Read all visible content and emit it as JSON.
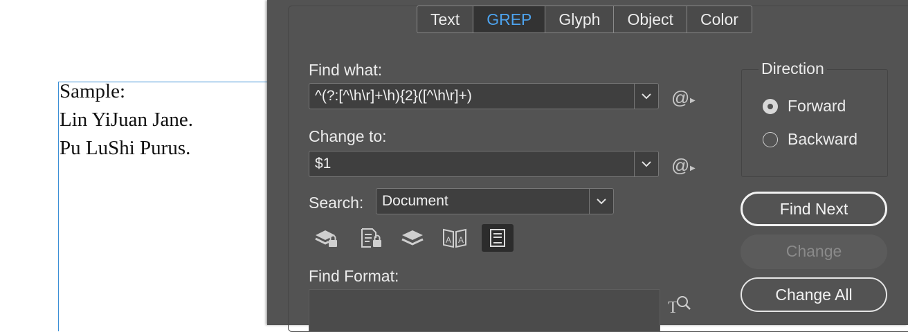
{
  "document": {
    "lines": [
      "Sample:",
      "Lin YiJuan Jane.",
      "Pu LuShi Purus."
    ]
  },
  "dialog": {
    "tabs": [
      {
        "label": "Text",
        "active": false
      },
      {
        "label": "GREP",
        "active": true
      },
      {
        "label": "Glyph",
        "active": false
      },
      {
        "label": "Object",
        "active": false
      },
      {
        "label": "Color",
        "active": false
      }
    ],
    "find_what": {
      "label": "Find what:",
      "value": "^(?:[^\\h\\r]+\\h){2}([^\\h\\r]+)"
    },
    "change_to": {
      "label": "Change to:",
      "value": "$1"
    },
    "search": {
      "label": "Search:",
      "value": "Document"
    },
    "toolbar_icons": [
      {
        "name": "include-locked-layers-icon",
        "active": false
      },
      {
        "name": "include-locked-stories-icon",
        "active": false
      },
      {
        "name": "include-hidden-layers-icon",
        "active": false
      },
      {
        "name": "include-master-pages-icon",
        "active": false
      },
      {
        "name": "include-footnotes-icon",
        "active": true
      }
    ],
    "find_format": {
      "label": "Find Format:"
    },
    "direction": {
      "legend": "Direction",
      "options": [
        {
          "label": "Forward",
          "selected": true
        },
        {
          "label": "Backward",
          "selected": false
        }
      ]
    },
    "buttons": {
      "find_next": "Find Next",
      "change": "Change",
      "change_all": "Change All"
    }
  },
  "colors": {
    "dialog_bg": "#535353",
    "active_tab_text": "#4da3ee",
    "frame_edge": "#3b8fd6"
  }
}
